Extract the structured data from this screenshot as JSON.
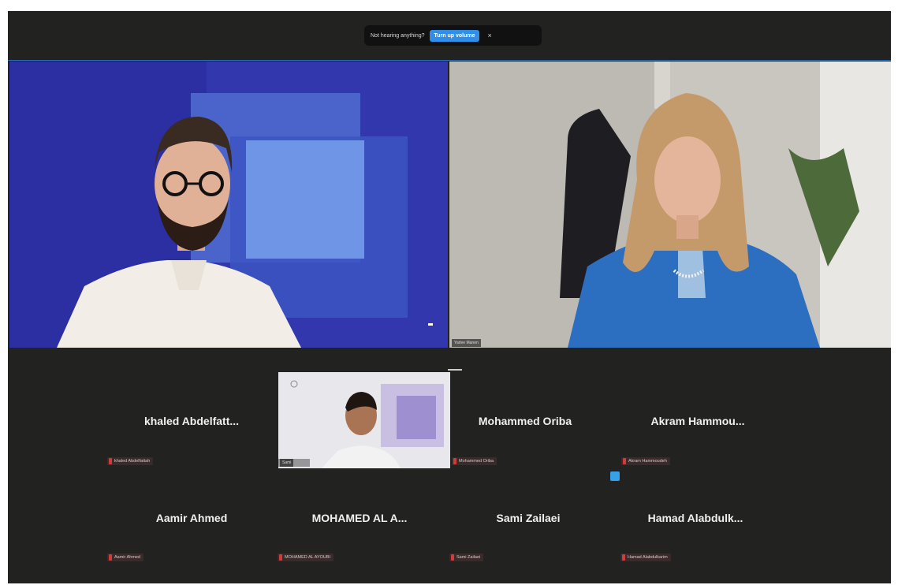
{
  "banner": {
    "text": "Not hearing anything?",
    "button_label": "Turn up volume",
    "close_glyph": "×"
  },
  "tiles": {
    "right_name": "Yarlee Manen"
  },
  "mini_tile": {
    "name": "Sami"
  },
  "gallery": [
    {
      "display_name": "khaled  Abdelfatt...",
      "tag": "khaled Abdelfattah"
    },
    {
      "display_name": "Mohammed Oriba",
      "tag": "Mohammed Oriba"
    },
    {
      "display_name": "Akram  Hammou...",
      "tag": "Akram Hammoudeh"
    },
    {
      "display_name": "Aamir Ahmed",
      "tag": "Aamir Ahmed"
    },
    {
      "display_name": "MOHAMED AL A...",
      "tag": "MOHAMED AL AYOUBI"
    },
    {
      "display_name": "Sami Zailaei",
      "tag": "Sami Zailaei"
    },
    {
      "display_name": "Hamad  Alabdulk...",
      "tag": "Hamad Alabdulkarim"
    }
  ],
  "icons": {
    "muted": "muted-mic-icon",
    "close": "close-icon"
  },
  "colors": {
    "background": "#222220",
    "accent": "#2f8fe8",
    "muted": "#d23b3b"
  }
}
